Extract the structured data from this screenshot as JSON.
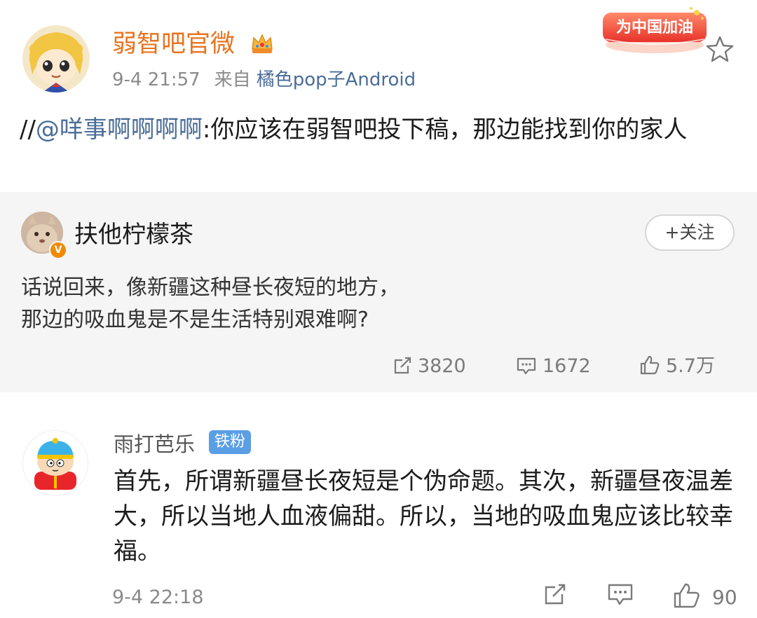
{
  "post": {
    "author": "弱智吧官微",
    "time": "9-4 21:57",
    "from_label": "来自",
    "source": "橘色pop子Android",
    "badge_text": "为中国加油",
    "text_prefix": "//",
    "mention": "@咩事啊啊啊啊",
    "text_body": ":你应该在弱智吧投下稿，那边能找到你的家人"
  },
  "quoted": {
    "author": "扶他柠檬茶",
    "verified_mark": "V",
    "follow_label": "+关注",
    "text_line1": "话说回来，像新疆这种昼长夜短的地方，",
    "text_line2": "那边的吸血鬼是不是生活特别艰难啊?",
    "reposts": "3820",
    "comments": "1672",
    "likes": "5.7万"
  },
  "comment": {
    "author": "雨打芭乐",
    "fan_badge": "铁粉",
    "text": "首先，所谓新疆昼长夜短是个伪命题。其次，新疆昼夜温差大，所以当地人血液偏甜。所以，当地的吸血鬼应该比较幸福。",
    "time": "9-4 22:18",
    "likes": "90"
  },
  "icons": {
    "crown": "crown-icon",
    "star": "star-icon",
    "repost": "repost-icon",
    "comment": "comment-icon",
    "like": "thumbs-up-icon"
  },
  "colors": {
    "author_orange": "#e8731f",
    "link_blue": "#4a6d98",
    "fan_badge": "#5a9ee6",
    "quote_bg": "#f5f5f5"
  }
}
